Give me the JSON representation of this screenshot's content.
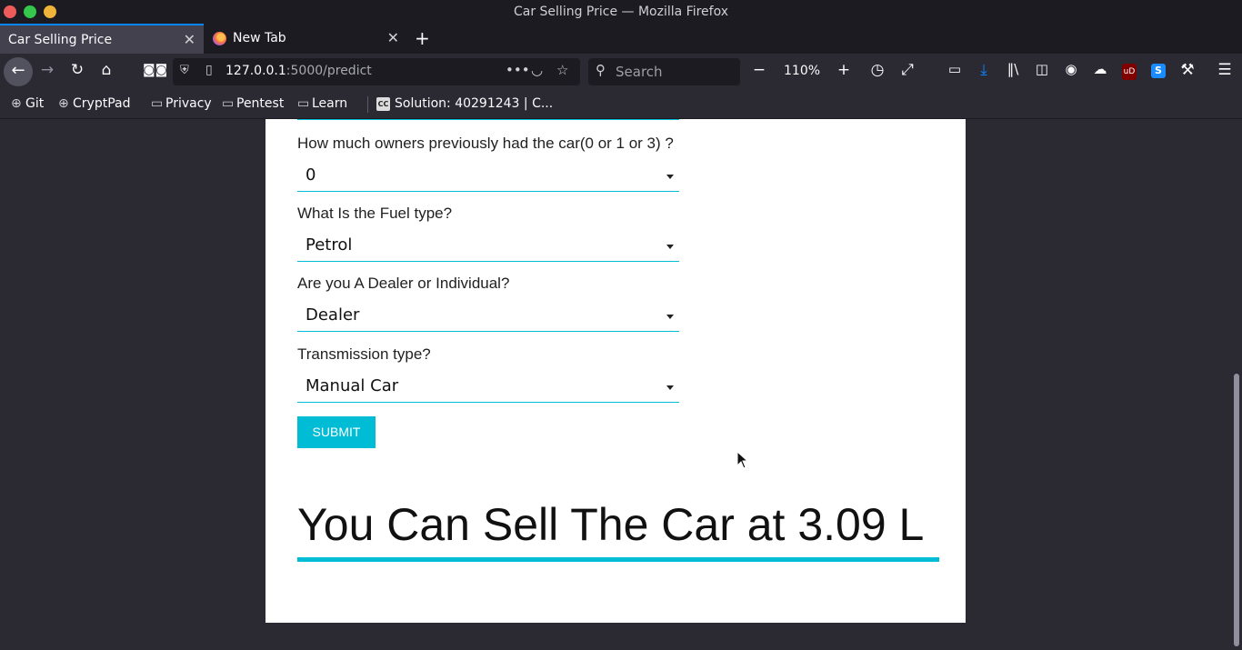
{
  "window": {
    "title": "Car Selling Price — Mozilla Firefox"
  },
  "tabs": [
    {
      "label": "Car Selling Price",
      "active": true
    },
    {
      "label": "New Tab",
      "active": false
    }
  ],
  "navbar": {
    "url_host": "127.0.0.1",
    "url_rest": ":5000/predict",
    "search_placeholder": "Search",
    "zoom": "110%"
  },
  "bookmarks": [
    {
      "label": "Git",
      "icon": "globe-icon"
    },
    {
      "label": "CryptPad",
      "icon": "globe-icon"
    },
    {
      "label": "Privacy",
      "icon": "folder-icon"
    },
    {
      "label": "Pentest",
      "icon": "folder-icon"
    },
    {
      "label": "Learn",
      "icon": "folder-icon"
    },
    {
      "label": "Solution: 40291243 | C...",
      "icon": "cc-icon"
    }
  ],
  "form": {
    "fields": [
      {
        "label": "How much owners previously had the car(0 or 1 or 3) ?",
        "value": "0"
      },
      {
        "label": "What Is the Fuel type?",
        "value": "Petrol"
      },
      {
        "label": "Are you A Dealer or Individual?",
        "value": "Dealer"
      },
      {
        "label": "Transmission type?",
        "value": "Manual Car"
      }
    ],
    "submit_label": "SUBMIT"
  },
  "result": {
    "text": "You Can Sell The Car at 3.09 L"
  },
  "colors": {
    "accent": "#00bcd4",
    "chrome": "#2b2a33",
    "titlebar": "#1c1b22"
  }
}
